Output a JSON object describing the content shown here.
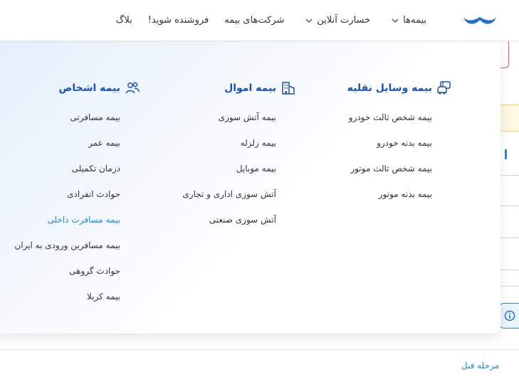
{
  "nav": {
    "items": [
      {
        "label": "بیمه‌ها",
        "has_chevron": true
      },
      {
        "label": "خسارت آنلاین",
        "has_chevron": true
      },
      {
        "label": "شرکت‌های بیمه",
        "has_chevron": false
      },
      {
        "label": "فروشنده شوید!",
        "has_chevron": false
      },
      {
        "label": "بلاگ",
        "has_chevron": false
      }
    ]
  },
  "mega_menu": {
    "vehicle": {
      "title": "بیمه وسایل نقلیه",
      "icon": "vehicle-icon",
      "items": [
        "بیمه شخص ثالث خودرو",
        "بیمه بدنه خودرو",
        "بیمه شخص ثالث موتور",
        "بیمه بدنه موتور"
      ]
    },
    "property": {
      "title": "بیمه اموال",
      "icon": "building-icon",
      "items": [
        "بیمه آتش سوزی",
        "بیمه زلزله",
        "بیمه موبایل",
        "آتش سوزی اداری و تجاری",
        "آتش سوزی صنعتی"
      ]
    },
    "personal": {
      "title": "بیمه اشخاص",
      "icon": "people-icon",
      "items": [
        "بیمه مسافرتی",
        "بیمه عمر",
        "درمان تکمیلی",
        "حوادث انفرادی",
        "بیمه مسافرت داخلی",
        "بیمه مسافرین ورودی به ایران",
        "حوادث گروهی",
        "بیمه کربلا"
      ],
      "active_index": 4
    }
  },
  "footer": {
    "prev_step": "مرحله قبل"
  },
  "colors": {
    "accent": "#1a52b8",
    "link": "#1e88e5",
    "error": "#e25a5a"
  }
}
